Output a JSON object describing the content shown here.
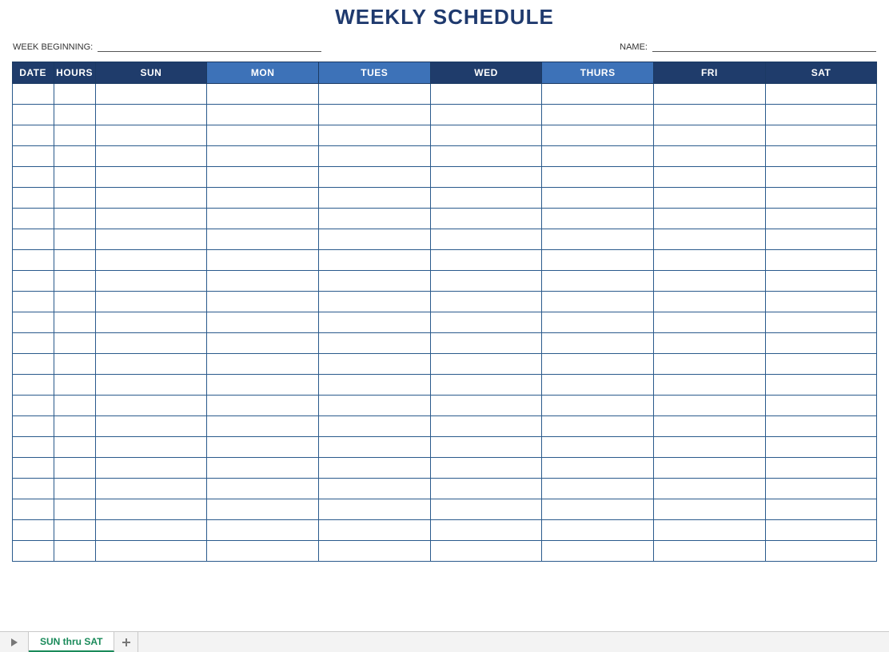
{
  "title": "WEEKLY SCHEDULE",
  "meta": {
    "week_beginning_label": "WEEK BEGINNING:",
    "week_beginning_value": "",
    "name_label": "NAME:",
    "name_value": ""
  },
  "columns": {
    "date": "DATE",
    "hours": "HOURS",
    "days": [
      "SUN",
      "MON",
      "TUES",
      "WED",
      "THURS",
      "FRI",
      "SAT"
    ]
  },
  "row_count": 23,
  "tabs": {
    "active": "SUN thru SAT"
  }
}
